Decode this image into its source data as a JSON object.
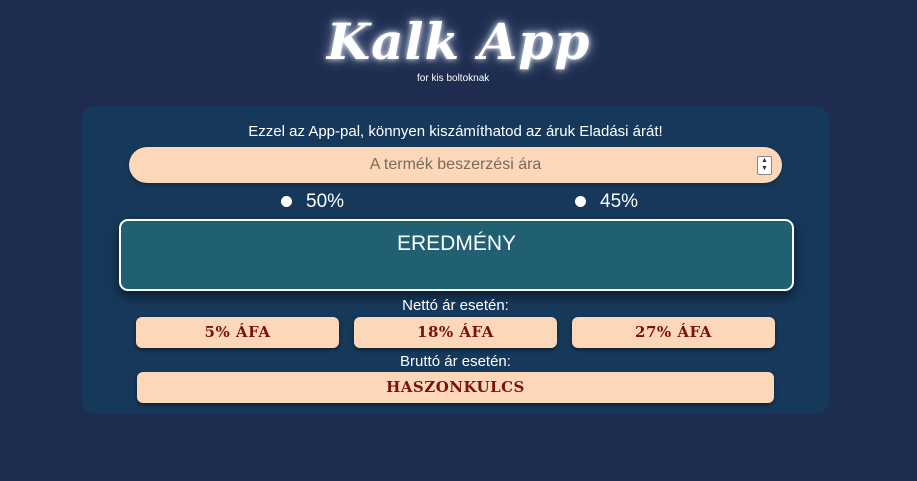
{
  "logo": {
    "title": "Kalk App",
    "subtitle": "for kis boltoknak"
  },
  "panel": {
    "intro": "Ezzel az App-pal, könnyen kiszámíthatod az áruk Eladási árát!",
    "price_input": {
      "placeholder": "A termék beszerzési ára",
      "value": ""
    },
    "radios": [
      {
        "label": "50%",
        "selected": false
      },
      {
        "label": "45%",
        "selected": false
      }
    ],
    "result_label": "EREDMÉNY",
    "netto_label": "Nettó ár esetén:",
    "vat_buttons": [
      "5% ÁFA",
      "18% ÁFA",
      "27% ÁFA"
    ],
    "brutto_label": "Bruttó ár esetén:",
    "margin_button": "HASZONKULCS"
  },
  "colors": {
    "background": "#1e2d4f",
    "panel": "#16395b",
    "input_fill": "#fcd8b8",
    "result_fill": "#215f72",
    "button_text": "#7a1010"
  }
}
